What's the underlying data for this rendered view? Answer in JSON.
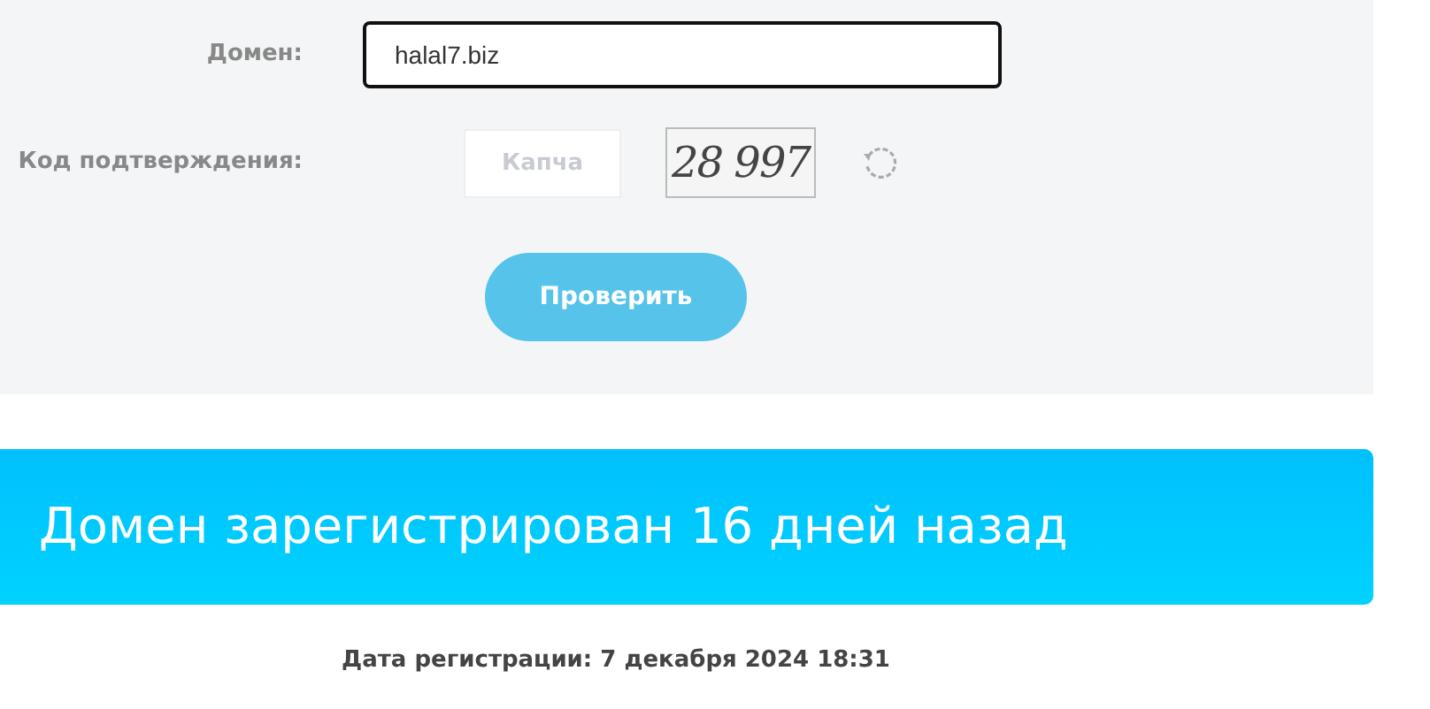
{
  "form": {
    "domain_label": "Домен:",
    "domain_value": "halal7.biz",
    "focused": true,
    "captcha_label": "Код подтверждения:",
    "captcha_placeholder": "Капча",
    "captcha_image_text": "28 997",
    "submit": "Проверить"
  },
  "result": {
    "banner": "Домен зарегистрирован 16 дней назад",
    "registration_date": "Дата регистрации: **7 декабря 2024 18:31**"
  }
}
